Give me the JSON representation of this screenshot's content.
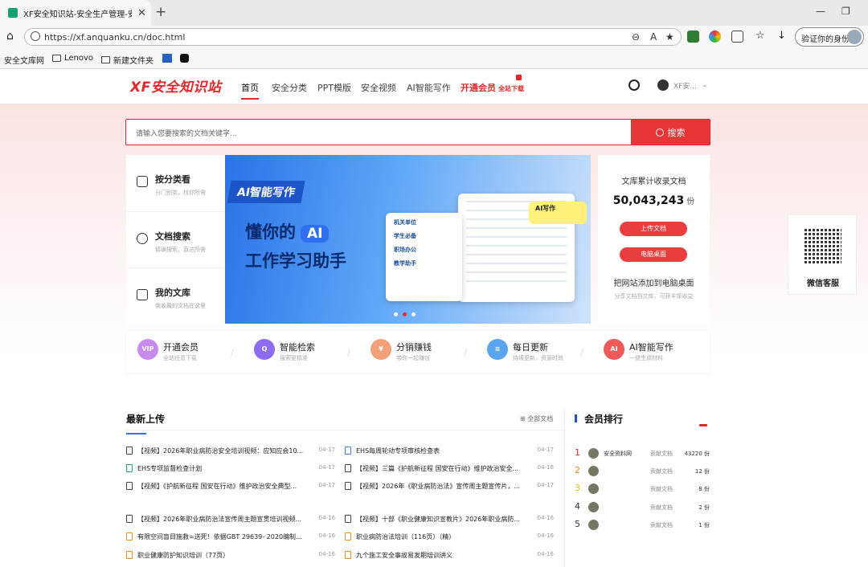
{
  "browser": {
    "tab_title": "XF安全知识站-安全生产管理-安全",
    "url": "https://xf.anquanku.cn/doc.html",
    "profile_label": "验证你的身份",
    "bookmarks": [
      "安全文库网",
      "Lenovo",
      "新建文件夹"
    ]
  },
  "site": {
    "logo": "XF安全知识站",
    "nav": [
      "首页",
      "安全分类",
      "PPT模版",
      "安全视频",
      "AI智能写作",
      "开通会员"
    ],
    "nav_vip_sub": "全站下载",
    "user_name": "XF安..."
  },
  "search": {
    "placeholder": "请输入您要搜索的文档关键字...",
    "button": "搜索"
  },
  "left_menu": [
    {
      "title": "按分类看",
      "sub": "分门别类，找你所需"
    },
    {
      "title": "文档搜索",
      "sub": "精确搜索，直达所需"
    },
    {
      "title": "我的文库",
      "sub": "我收藏的文档在这里"
    }
  ],
  "banner": {
    "tag": "AI智能写作",
    "line1": "懂你的",
    "ai": "AI",
    "line2": "工作学习助手",
    "bubble": "AI写作",
    "cards": [
      "机关单位",
      "学生必备",
      "职场办公",
      "教学助手"
    ]
  },
  "stats": {
    "label": "文库累计收录文档",
    "count": "50,043,243",
    "unit": "份",
    "upload_btn": "上传文档",
    "desktop_btn": "电脑桌面",
    "tip": "把网站添加到电脑桌面",
    "tip_sub": "分享文档到文库，可获丰厚收益"
  },
  "qr": {
    "label": "微信客服"
  },
  "features": [
    {
      "title": "开通会员",
      "sub": "全站任意下载",
      "icon": "VIP",
      "color": "#c98af0"
    },
    {
      "title": "智能检索",
      "sub": "搜索更精准",
      "icon": "Q",
      "color": "#8d6cf3"
    },
    {
      "title": "分销赚钱",
      "sub": "带你一起赚钱",
      "icon": "¥",
      "color": "#f3a07a"
    },
    {
      "title": "每日更新",
      "sub": "持续更新，资源时效",
      "icon": "≡",
      "color": "#5aa4f0"
    },
    {
      "title": "AI智能写作",
      "sub": "一键生成材料",
      "icon": "AI",
      "color": "#ee5a5a"
    }
  ],
  "latest": {
    "title": "最新上传",
    "all": "全部文档",
    "left": [
      {
        "title": "【视频】2026年职业病防治安全培训视频：应知应会10...",
        "date": "04-17",
        "type": "doc"
      },
      {
        "title": "EHS专项监督检查计划",
        "date": "04-17",
        "type": "green"
      },
      {
        "title": "【视频】《护航新征程 国安在行动》维护政治安全典型...",
        "date": "04-17",
        "type": "doc"
      },
      {
        "title": "【视频】2026年职业病防治法宣传周主题宣贯培训视频...",
        "date": "04-16",
        "type": "doc"
      },
      {
        "title": "有限空间盲目施救=送死！依据GBT 29639- 2020编制...",
        "date": "04-16",
        "type": "orange"
      },
      {
        "title": "职业健康防护知识培训（77页）",
        "date": "04-16",
        "type": "orange"
      }
    ],
    "right": [
      {
        "title": "EHS每周轮动专项审核检查表",
        "date": "04-17",
        "type": "blue"
      },
      {
        "title": "【视频】三篇《护航新征程 国安在行动》维护政治安全...",
        "date": "04-16",
        "type": "doc"
      },
      {
        "title": "【视频】2026年《职业病防治法》宣传周主题宣传片，...",
        "date": "04-17",
        "type": "doc"
      },
      {
        "title": "【视频】十部《职业健康知识宣教片》2026年职业病防...",
        "date": "04-16",
        "type": "doc"
      },
      {
        "title": "职业病防治法培训（116页）（精）",
        "date": "04-16",
        "type": "orange"
      },
      {
        "title": "九个施工安全事故易发期培训讲义",
        "date": "04-16",
        "type": "orange"
      }
    ]
  },
  "ranking": {
    "title": "会员排行",
    "label": "贡献文档",
    "items": [
      {
        "n": "1",
        "name": "安全资料网",
        "count": "43220 份",
        "color": "#e3282c"
      },
      {
        "n": "2",
        "name": "",
        "count": "12 份",
        "color": "#f08a24"
      },
      {
        "n": "3",
        "name": "",
        "count": "8 份",
        "color": "#f5b400"
      },
      {
        "n": "4",
        "name": "",
        "count": "2 份",
        "color": "#333333"
      },
      {
        "n": "5",
        "name": "",
        "count": "1 份",
        "color": "#333333"
      }
    ]
  }
}
